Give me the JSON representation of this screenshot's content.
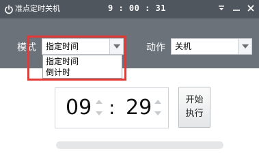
{
  "titlebar": {
    "title": "准点定时关机",
    "clock": "9 : 00 : 31",
    "icons": {
      "app": "power-icon",
      "menu": "menu-icon",
      "minimize": "minimize-icon",
      "close": "close-icon"
    }
  },
  "mode": {
    "label": "模式",
    "selected": "指定时间",
    "options": [
      "指定时间",
      "倒计时"
    ]
  },
  "action": {
    "label": "动作",
    "selected": "关机"
  },
  "timer": {
    "hours": "09",
    "separator": ":",
    "minutes": "29"
  },
  "start_button": {
    "line1": "开始",
    "line2": "执行"
  },
  "progress": {
    "value": 0
  },
  "colors": {
    "titlebar": "#4f565e",
    "toolbar": "#6b727a",
    "highlight": "#e53935",
    "progress_track": "#e4e6e8"
  }
}
